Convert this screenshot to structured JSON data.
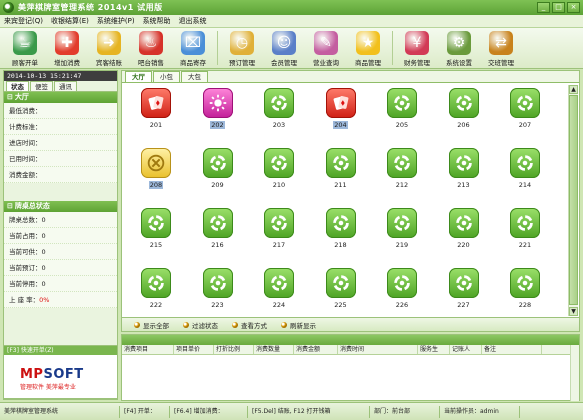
{
  "window": {
    "title": "美萍棋牌室管理系统 2014v1 试用版",
    "controls": [
      "_",
      "□",
      "×"
    ]
  },
  "menu": [
    "来宾登记(Q)",
    "收银结算(E)",
    "系统维护(P)",
    "系统帮助",
    "退出系统"
  ],
  "toolbar": [
    {
      "label": "顾客开单",
      "icon": "teacup-icon",
      "color": "#3a9a4a",
      "glyph": "☕"
    },
    {
      "label": "增加消费",
      "icon": "add-consumption-icon",
      "color": "#e23c2c",
      "glyph": "✚"
    },
    {
      "label": "宾客结账",
      "icon": "checkout-arrow-icon",
      "color": "#e6b422",
      "glyph": "➜"
    },
    {
      "label": "吧台销售",
      "icon": "bar-sales-icon",
      "color": "#d6322a",
      "glyph": "♨"
    },
    {
      "label": "商品寄存",
      "icon": "storage-basket-icon",
      "color": "#4b8fd8",
      "glyph": "⌧"
    },
    {
      "label": "预订管理",
      "icon": "clock-icon",
      "color": "#e0b038",
      "glyph": "◷"
    },
    {
      "label": "会员管理",
      "icon": "members-icon",
      "color": "#5a7fc8",
      "glyph": "☺"
    },
    {
      "label": "营业查询",
      "icon": "query-brush-icon",
      "color": "#c45ea0",
      "glyph": "✎"
    },
    {
      "label": "商品管理",
      "icon": "star-icon",
      "color": "#f2c01c",
      "glyph": "★"
    },
    {
      "label": "财务管理",
      "icon": "finance-icon",
      "color": "#d23a56",
      "glyph": "¥"
    },
    {
      "label": "系统设置",
      "icon": "settings-gear-icon",
      "color": "#6a9a3c",
      "glyph": "⚙"
    },
    {
      "label": "交班管理",
      "icon": "handover-icon",
      "color": "#c8821c",
      "glyph": "⇄"
    }
  ],
  "left": {
    "datetime": "2014-10-13 15:21:47",
    "tabs": [
      "状态",
      "便签",
      "通讯"
    ],
    "hall": {
      "title": "大厅",
      "fields": [
        {
          "label": "最低消费：",
          "value": ""
        },
        {
          "label": "计费标准：",
          "value": ""
        },
        {
          "label": "进店时间：",
          "value": ""
        },
        {
          "label": "已用时间：",
          "value": ""
        },
        {
          "label": "消费金额：",
          "value": ""
        }
      ]
    },
    "summary": {
      "title": "牌桌总状态",
      "fields": [
        {
          "label": "牌桌总数：",
          "value": "0"
        },
        {
          "label": "当前占用：",
          "value": "0"
        },
        {
          "label": "当前可供：",
          "value": "0"
        },
        {
          "label": "当前预订：",
          "value": "0"
        },
        {
          "label": "当前停用：",
          "value": "0"
        },
        {
          "label": "上 座 率：",
          "value": "0%"
        }
      ]
    },
    "logo": {
      "bar": "[F3] 快速开单(Z)",
      "brand_a": "MP",
      "brand_b": "SOFT",
      "slogan": "管理软件  美萍最专业"
    }
  },
  "main": {
    "tabs": [
      "大厅",
      "小包",
      "大包"
    ],
    "tables": [
      {
        "num": "201",
        "state": "red"
      },
      {
        "num": "202",
        "state": "magenta",
        "selected": true
      },
      {
        "num": "203",
        "state": "green"
      },
      {
        "num": "204",
        "state": "red",
        "selected": true
      },
      {
        "num": "205",
        "state": "green"
      },
      {
        "num": "206",
        "state": "green"
      },
      {
        "num": "207",
        "state": "green"
      },
      {
        "num": "208",
        "state": "yellow",
        "selected": true
      },
      {
        "num": "209",
        "state": "green"
      },
      {
        "num": "210",
        "state": "green"
      },
      {
        "num": "211",
        "state": "green"
      },
      {
        "num": "212",
        "state": "green"
      },
      {
        "num": "213",
        "state": "green"
      },
      {
        "num": "214",
        "state": "green"
      },
      {
        "num": "215",
        "state": "green"
      },
      {
        "num": "216",
        "state": "green"
      },
      {
        "num": "217",
        "state": "green"
      },
      {
        "num": "218",
        "state": "green"
      },
      {
        "num": "219",
        "state": "green"
      },
      {
        "num": "220",
        "state": "green"
      },
      {
        "num": "221",
        "state": "green"
      },
      {
        "num": "222",
        "state": "green"
      },
      {
        "num": "223",
        "state": "green"
      },
      {
        "num": "224",
        "state": "green"
      },
      {
        "num": "225",
        "state": "green"
      },
      {
        "num": "226",
        "state": "green"
      },
      {
        "num": "227",
        "state": "green"
      },
      {
        "num": "228",
        "state": "green"
      }
    ],
    "actions": [
      "显示全部",
      "过滤状态",
      "查看方式",
      "刷新显示"
    ]
  },
  "detail": {
    "columns": [
      "消费项目",
      "项目单价",
      "打折比例",
      "消费数量",
      "消费金额",
      "消费时间",
      "服务生",
      "记账人",
      "备注"
    ]
  },
  "statusbar": [
    "美萍棋牌室管理系统",
    "[F4] 开单：",
    "[F6.4] 增加消费：",
    "[F5.Del] 结账, F12 打开钱箱",
    "部门：前台部",
    "当前操作员：admin"
  ]
}
